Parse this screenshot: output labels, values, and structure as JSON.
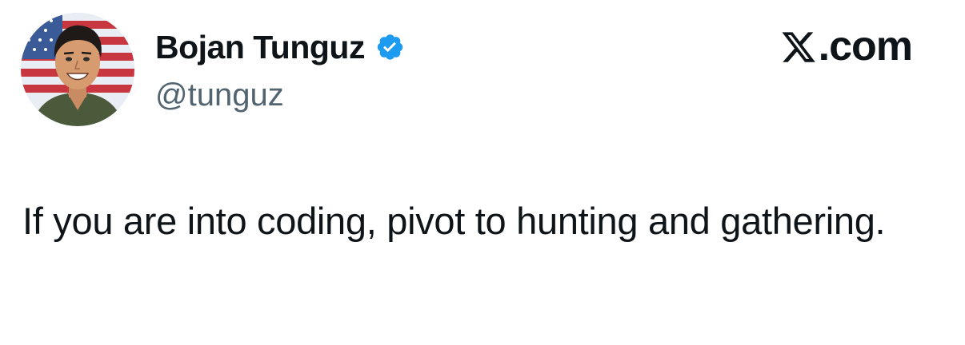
{
  "author": {
    "display_name": "Bojan Tunguz",
    "handle": "@tunguz",
    "verified": true,
    "verified_icon": "verified-badge-icon"
  },
  "brand": {
    "logo_icon": "x-logo-icon",
    "suffix": ".com"
  },
  "tweet": {
    "text": "If you are into coding, pivot to hunting and gathering."
  },
  "colors": {
    "text_primary": "#0f1419",
    "text_secondary": "#536471",
    "verified_blue": "#1d9bf0",
    "background": "#ffffff"
  }
}
